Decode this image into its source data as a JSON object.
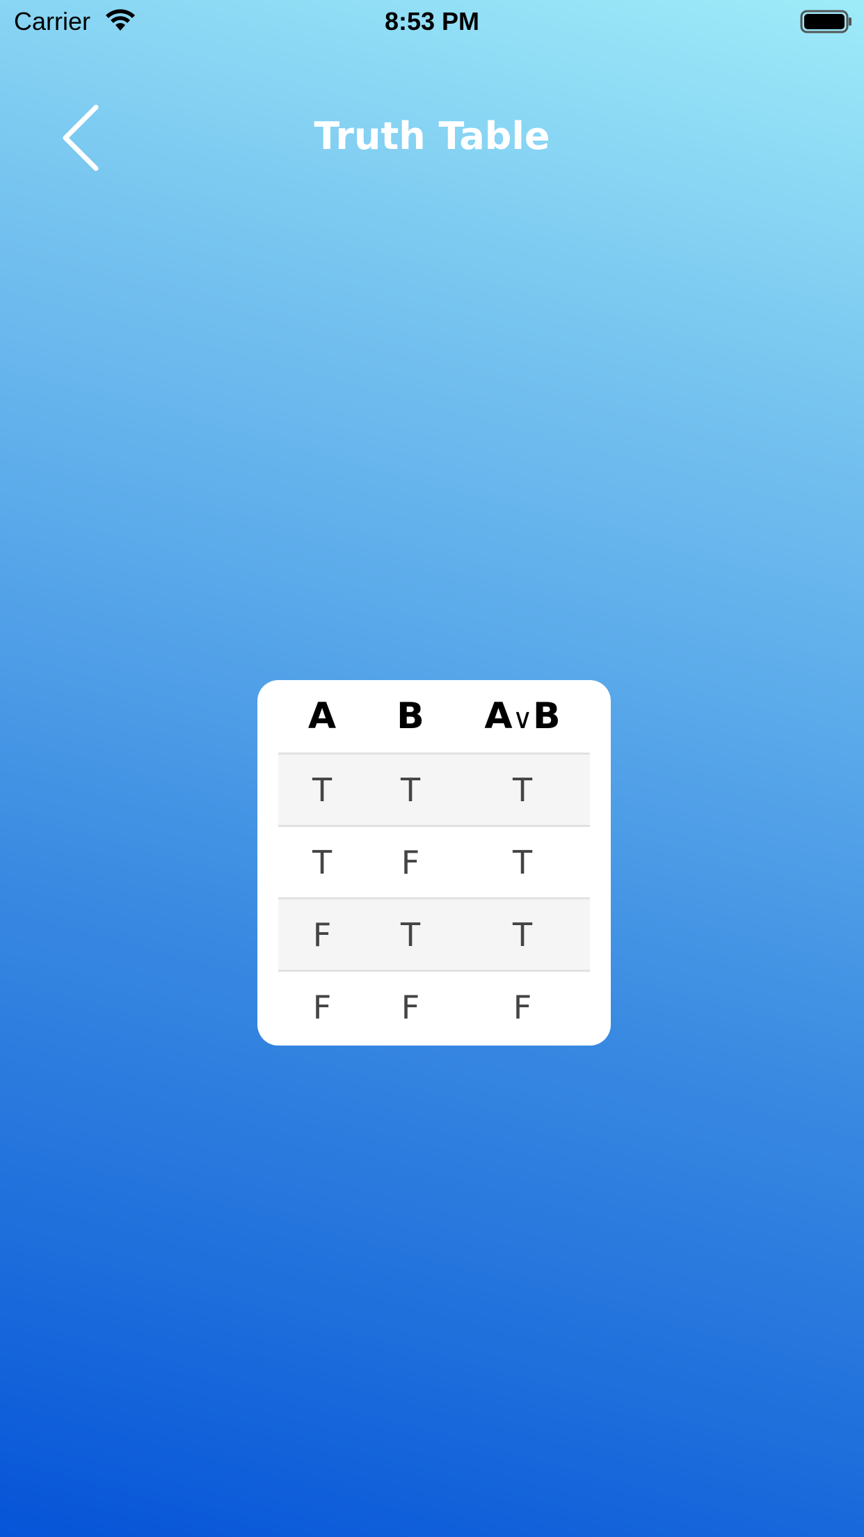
{
  "status_bar": {
    "carrier": "Carrier",
    "time": "8:53 PM",
    "icons": [
      "wifi-icon",
      "battery-icon"
    ]
  },
  "nav": {
    "title": "Truth Table",
    "back_icon": "chevron-left-icon"
  },
  "table": {
    "headers": {
      "a": "A",
      "b": "B",
      "result_left": "A",
      "result_op": "∨",
      "result_right": "B"
    },
    "rows": [
      [
        "T",
        "T",
        "T"
      ],
      [
        "T",
        "F",
        "T"
      ],
      [
        "F",
        "T",
        "T"
      ],
      [
        "F",
        "F",
        "F"
      ]
    ]
  },
  "colors": {
    "gradient_top": "#9eebf9",
    "gradient_bottom": "#0654d8",
    "card": "#ffffff",
    "shaded_row": "#f5f5f5"
  }
}
